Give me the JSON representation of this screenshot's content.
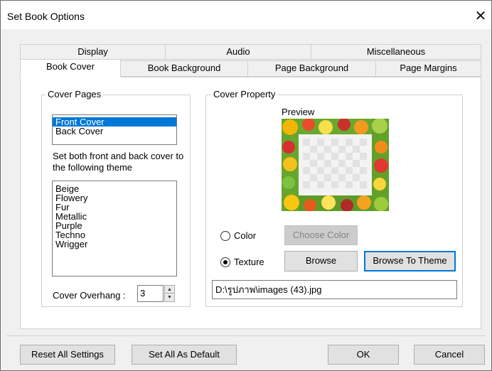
{
  "window": {
    "title": "Set Book Options"
  },
  "tabs": {
    "row1": [
      {
        "label": "Display"
      },
      {
        "label": "Audio"
      },
      {
        "label": "Miscellaneous"
      }
    ],
    "row2": [
      {
        "label": "Book Cover",
        "active": true
      },
      {
        "label": "Book Background"
      },
      {
        "label": "Page Background"
      },
      {
        "label": "Page Margins"
      }
    ]
  },
  "cover_pages": {
    "group_label": "Cover Pages",
    "pages": [
      "Front Cover",
      "Back Cover"
    ],
    "selected_page": "Front Cover",
    "theme_instruction": "Set both front and back cover to the following theme",
    "themes": [
      "Beige",
      "Flowery",
      "Fur",
      "Metallic",
      "Purple",
      "Techno",
      "Wrigger"
    ],
    "overhang_label": "Cover Overhang :",
    "overhang_value": "3"
  },
  "cover_property": {
    "group_label": "Cover Property",
    "preview_label": "Preview",
    "color_option": "Color",
    "texture_option": "Texture",
    "selected_option": "Texture",
    "choose_color_button": "Choose Color",
    "browse_button": "Browse",
    "browse_theme_button": "Browse To Theme",
    "texture_path": "D:\\รูปภาพ\\images (43).jpg"
  },
  "footer": {
    "reset_button": "Reset All Settings",
    "set_default_button": "Set All As Default",
    "ok_button": "OK",
    "cancel_button": "Cancel"
  },
  "icons": {
    "close": "close-icon",
    "spin_up": "spin-up-arrow-icon",
    "spin_down": "spin-down-arrow-icon"
  },
  "colors": {
    "selection": "#0078d7",
    "button_face": "#e1e1e1",
    "panel": "#ffffff",
    "dialog": "#f0f0f0"
  }
}
